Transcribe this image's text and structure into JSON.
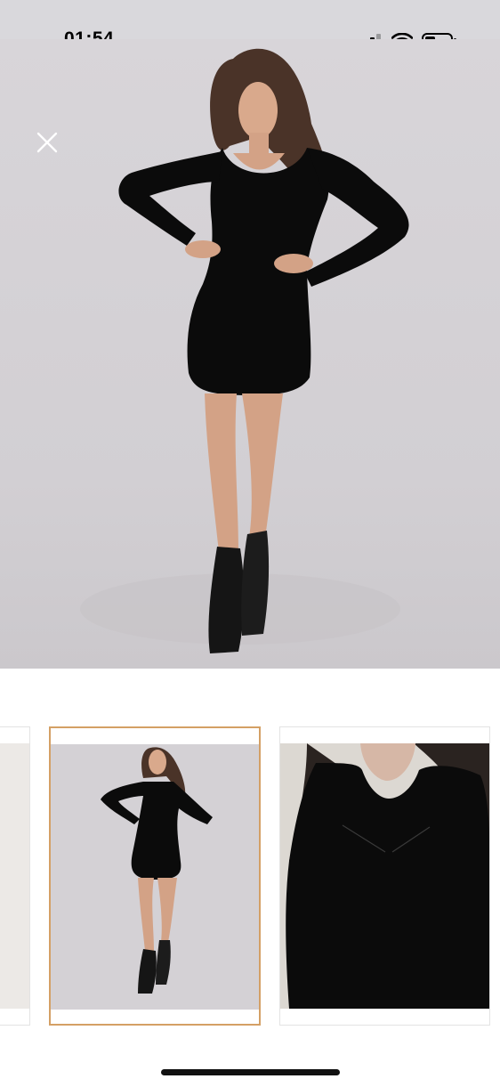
{
  "status_bar": {
    "time": "01:54"
  },
  "colors": {
    "accent": "#d4a065",
    "background": "#ffffff",
    "photo_backdrop": "#d5d2d6"
  },
  "icons": {
    "close": "close-icon",
    "signal": "signal-icon",
    "wifi": "wifi-icon",
    "battery": "battery-icon"
  },
  "gallery": {
    "selected_index": 1,
    "thumbnail_count": 3
  }
}
